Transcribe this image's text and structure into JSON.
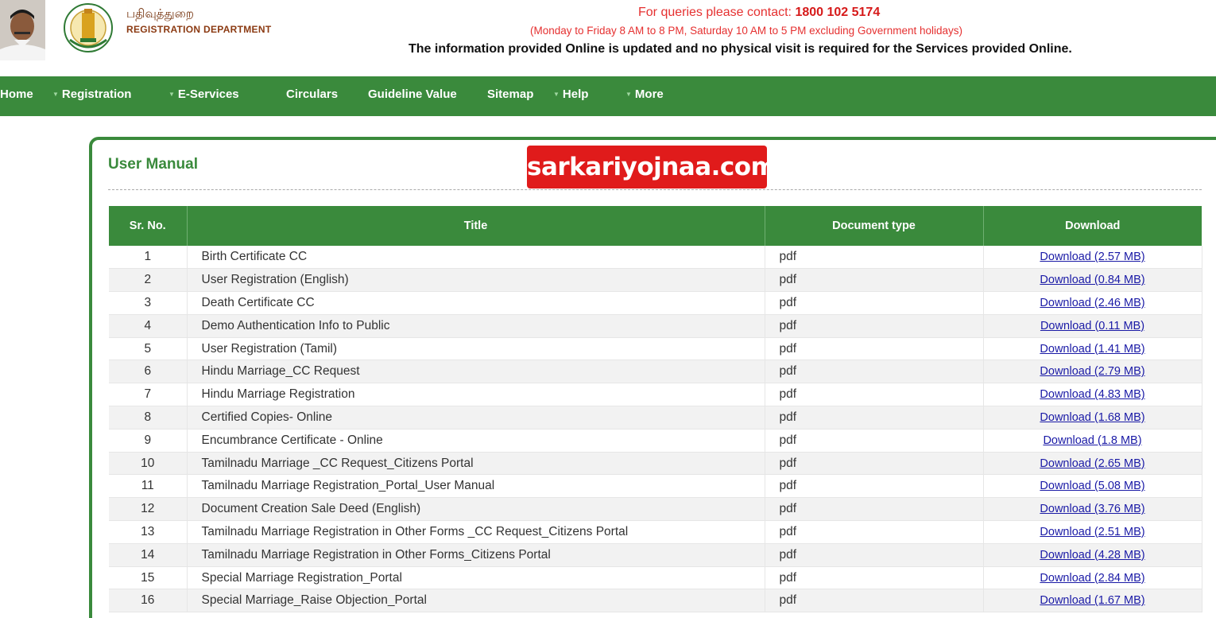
{
  "header": {
    "dept_tamil": "பதிவுத்துறை",
    "dept_english": "REGISTRATION DEPARTMENT",
    "contact_prefix": "For queries please contact: ",
    "contact_number": "1800 102 5174",
    "hours": "(Monday to Friday 8 AM to 8 PM, Saturday 10 AM to 5 PM excluding Government holidays)",
    "info": "The information provided Online is updated and no physical visit is required for the Services provided Online."
  },
  "nav": [
    {
      "label": "Home",
      "dropdown": false
    },
    {
      "label": "Registration",
      "dropdown": true
    },
    {
      "label": "E-Services",
      "dropdown": true
    },
    {
      "label": "Circulars",
      "dropdown": false
    },
    {
      "label": "Guideline Value",
      "dropdown": false
    },
    {
      "label": "Sitemap",
      "dropdown": false
    },
    {
      "label": "Help",
      "dropdown": true
    },
    {
      "label": "More",
      "dropdown": true
    }
  ],
  "page_title": "User Manual",
  "watermark": "sarkariyojnaa.com",
  "table": {
    "columns": [
      "Sr. No.",
      "Title",
      "Document type",
      "Download"
    ],
    "rows": [
      {
        "sr": "1",
        "title": "Birth Certificate CC",
        "type": "pdf",
        "download": "Download (2.57 MB)"
      },
      {
        "sr": "2",
        "title": "User Registration (English)",
        "type": "pdf",
        "download": "Download (0.84 MB)"
      },
      {
        "sr": "3",
        "title": "Death Certificate CC",
        "type": "pdf",
        "download": "Download (2.46 MB)"
      },
      {
        "sr": "4",
        "title": "Demo Authentication Info to Public",
        "type": "pdf",
        "download": "Download (0.11 MB)"
      },
      {
        "sr": "5",
        "title": "User Registration (Tamil)",
        "type": "pdf",
        "download": "Download (1.41 MB)"
      },
      {
        "sr": "6",
        "title": "Hindu Marriage_CC Request",
        "type": "pdf",
        "download": "Download (2.79 MB)"
      },
      {
        "sr": "7",
        "title": "Hindu Marriage Registration",
        "type": "pdf",
        "download": "Download (4.83 MB)"
      },
      {
        "sr": "8",
        "title": "Certified Copies- Online",
        "type": "pdf",
        "download": "Download (1.68 MB)"
      },
      {
        "sr": "9",
        "title": "Encumbrance Certificate - Online",
        "type": "pdf",
        "download": "Download (1.8 MB)"
      },
      {
        "sr": "10",
        "title": "Tamilnadu Marriage _CC Request_Citizens Portal",
        "type": "pdf",
        "download": "Download (2.65 MB)"
      },
      {
        "sr": "11",
        "title": "Tamilnadu Marriage Registration_Portal_User Manual",
        "type": "pdf",
        "download": "Download (5.08 MB)"
      },
      {
        "sr": "12",
        "title": "Document Creation Sale Deed (English)",
        "type": "pdf",
        "download": "Download (3.76 MB)"
      },
      {
        "sr": "13",
        "title": "Tamilnadu Marriage Registration in Other Forms _CC Request_Citizens Portal",
        "type": "pdf",
        "download": "Download (2.51 MB)"
      },
      {
        "sr": "14",
        "title": "Tamilnadu Marriage Registration in Other Forms_Citizens Portal",
        "type": "pdf",
        "download": "Download (4.28 MB)"
      },
      {
        "sr": "15",
        "title": "Special Marriage Registration_Portal",
        "type": "pdf",
        "download": "Download (2.84 MB)"
      },
      {
        "sr": "16",
        "title": "Special Marriage_Raise Objection_Portal",
        "type": "pdf",
        "download": "Download (1.67 MB)"
      }
    ]
  },
  "colors": {
    "nav_green": "#3a8a3c",
    "contact_red": "#e53030",
    "link_blue": "#1a1aa6",
    "watermark_red": "#e01b1b"
  }
}
